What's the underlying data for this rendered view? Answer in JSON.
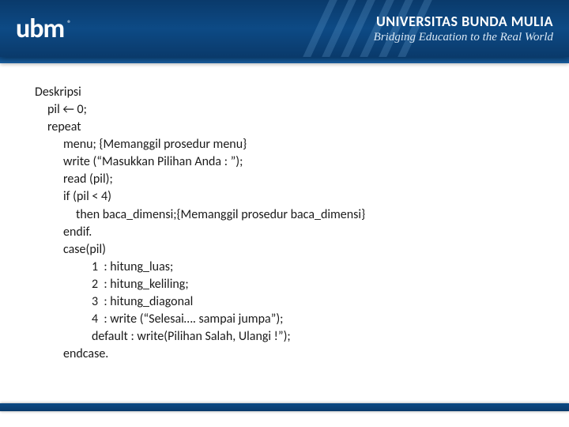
{
  "header": {
    "logo_text": "ubm",
    "logo_reg": "®",
    "university": "UNIVERSITAS BUNDA MULIA",
    "tagline": "Bridging Education to the Real World"
  },
  "code": {
    "l0": "Deskripsi",
    "l1": "pil ← 0;",
    "l2": "repeat",
    "l3": "menu; {Memanggil prosedur menu}",
    "l4": "write (“Masukkan Pilihan Anda : ”);",
    "l5": "read (pil);",
    "l6": "if (pil < 4)",
    "l7": "then baca_dimensi;{Memanggil prosedur baca_dimensi}",
    "l8": "endif.",
    "l9": "case(pil)",
    "l10": "1  : hitung_luas;",
    "l11": "2  : hitung_keliling;",
    "l12": "3  : hitung_diagonal",
    "l13": "4  : write (“Selesai…. sampai jumpa”);",
    "l14": "default : write(Pilihan Salah, Ulangi !”);",
    "l15": "endcase."
  }
}
